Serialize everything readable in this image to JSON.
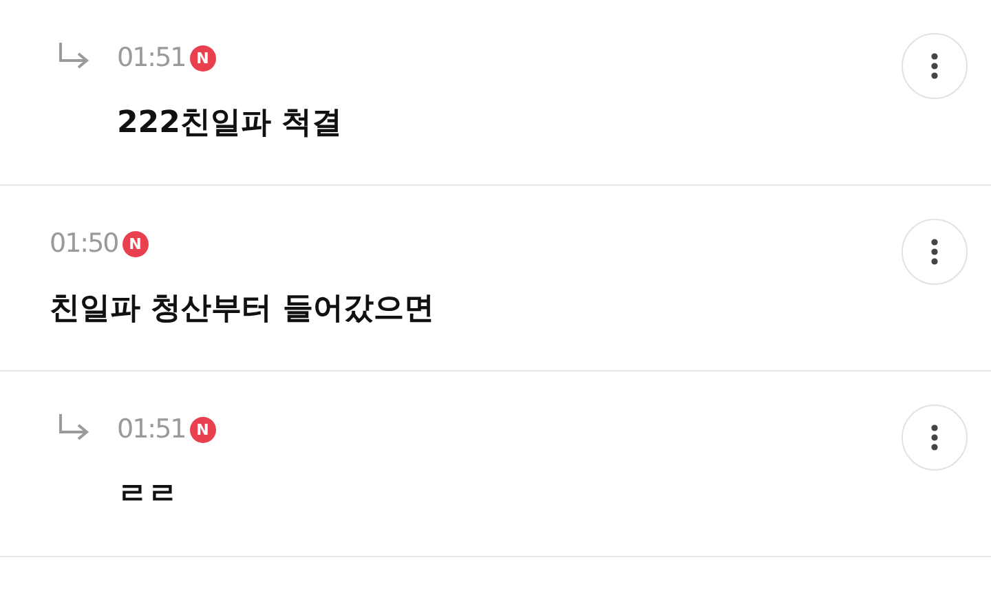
{
  "comments": [
    {
      "kind": "reply",
      "time": "01:51",
      "badge": "N",
      "text": "222친일파 척결"
    },
    {
      "kind": "comment",
      "time": "01:50",
      "badge": "N",
      "text": "친일파 청산부터 들어갔으면"
    },
    {
      "kind": "reply",
      "time": "01:51",
      "badge": "N",
      "text": "ㄹㄹ"
    }
  ]
}
